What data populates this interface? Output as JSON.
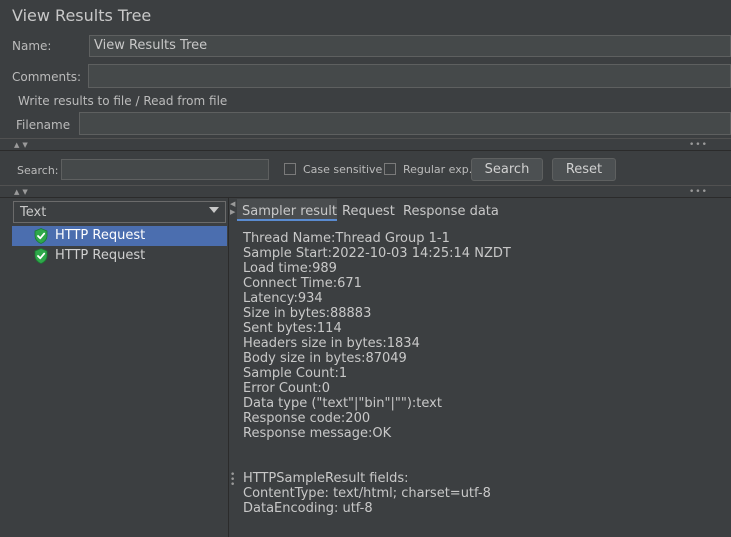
{
  "window": {
    "title": "View Results Tree"
  },
  "form": {
    "name_label": "Name:",
    "name_value": "View Results Tree",
    "comments_label": "Comments:",
    "comments_value": "",
    "write_results_label": "Write results to file / Read from file",
    "filename_label": "Filename",
    "filename_value": ""
  },
  "search_bar": {
    "search_label": "Search:",
    "search_value": "",
    "case_sensitive_label": "Case sensitive",
    "case_sensitive_checked": false,
    "regular_exp_label": "Regular exp.",
    "regular_exp_checked": false,
    "search_button": "Search",
    "reset_button": "Reset"
  },
  "renderer": {
    "selected": "Text"
  },
  "tree": {
    "items": [
      {
        "label": "HTTP Request",
        "status": "success",
        "selected": true
      },
      {
        "label": "HTTP Request",
        "status": "success",
        "selected": false
      }
    ]
  },
  "tabs": [
    {
      "label": "Sampler result",
      "active": true
    },
    {
      "label": "Request",
      "active": false
    },
    {
      "label": "Response data",
      "active": false
    }
  ],
  "sampler_result": {
    "lines": [
      "Thread Name:Thread Group 1-1",
      "Sample Start:2022-10-03 14:25:14 NZDT",
      "Load time:989",
      "Connect Time:671",
      "Latency:934",
      "Size in bytes:88883",
      "Sent bytes:114",
      "Headers size in bytes:1834",
      "Body size in bytes:87049",
      "Sample Count:1",
      "Error Count:0",
      "Data type (\"text\"|\"bin\"|\"\"):text",
      "Response code:200",
      "Response message:OK",
      "",
      "",
      "HTTPSampleResult fields:",
      "ContentType: text/html; charset=utf-8",
      "DataEncoding: utf-8"
    ]
  },
  "colors": {
    "background": "#3c3f41",
    "selection": "#4b6eaf",
    "success_icon": "#2ea84a"
  },
  "icons": {
    "collapse_arrows": "up-down-arrows-icon",
    "more": "ellipsis-icon",
    "dropdown": "chevron-down-icon",
    "sample_ok": "green-shield-check-icon"
  }
}
